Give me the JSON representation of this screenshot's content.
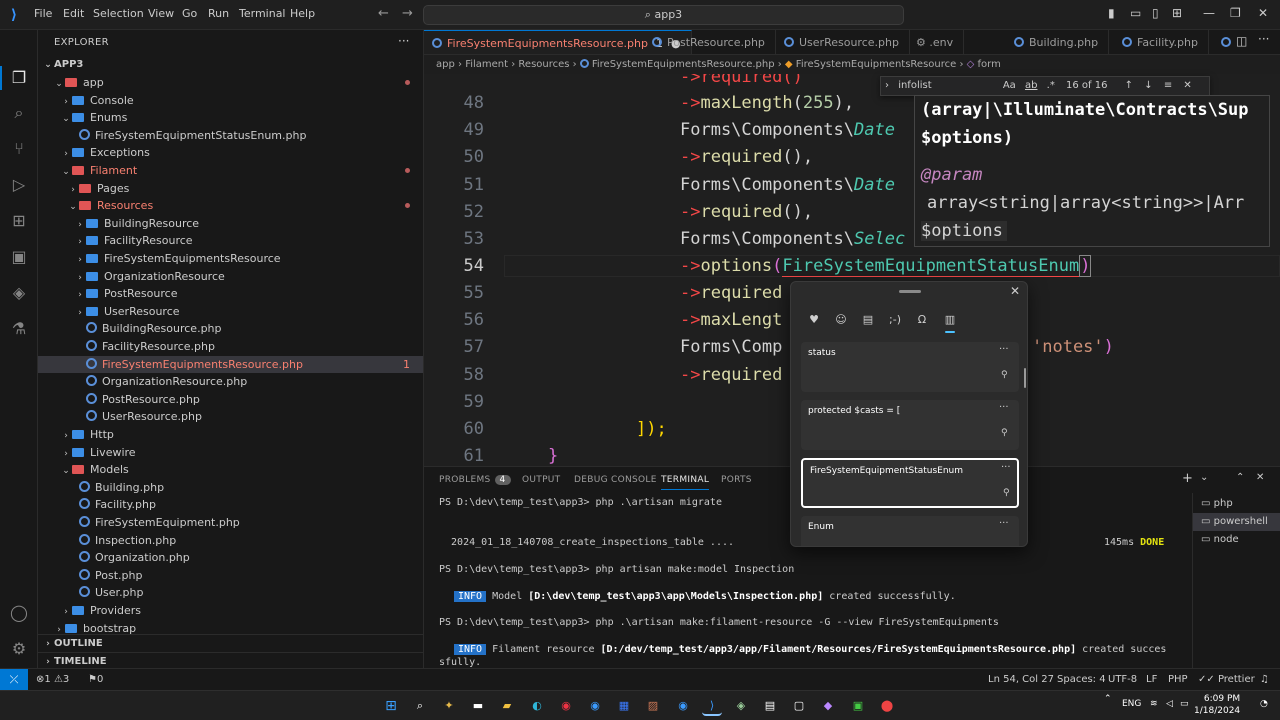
{
  "menu": [
    "File",
    "Edit",
    "Selection",
    "View",
    "Go",
    "Run",
    "Terminal",
    "Help"
  ],
  "command_center": "app3",
  "explorer": {
    "title": "EXPLORER",
    "root": "APP3",
    "tree": [
      {
        "label": "app",
        "depth": 1,
        "type": "folder-red",
        "open": true,
        "mod": true
      },
      {
        "label": "Console",
        "depth": 2,
        "type": "folder",
        "open": false
      },
      {
        "label": "Enums",
        "depth": 2,
        "type": "folder",
        "open": true
      },
      {
        "label": "FireSystemEquipmentStatusEnum.php",
        "depth": 3,
        "type": "php"
      },
      {
        "label": "Exceptions",
        "depth": 2,
        "type": "folder",
        "open": false
      },
      {
        "label": "Filament",
        "depth": 2,
        "type": "folder-red",
        "open": true,
        "mod": true,
        "cls": "error"
      },
      {
        "label": "Pages",
        "depth": 3,
        "type": "folder-red",
        "open": false
      },
      {
        "label": "Resources",
        "depth": 3,
        "type": "folder-red",
        "open": true,
        "mod": true,
        "cls": "error"
      },
      {
        "label": "BuildingResource",
        "depth": 4,
        "type": "folder",
        "open": false
      },
      {
        "label": "FacilityResource",
        "depth": 4,
        "type": "folder",
        "open": false
      },
      {
        "label": "FireSystemEquipmentsResource",
        "depth": 4,
        "type": "folder",
        "open": false
      },
      {
        "label": "OrganizationResource",
        "depth": 4,
        "type": "folder",
        "open": false
      },
      {
        "label": "PostResource",
        "depth": 4,
        "type": "folder",
        "open": false
      },
      {
        "label": "UserResource",
        "depth": 4,
        "type": "folder",
        "open": false
      },
      {
        "label": "BuildingResource.php",
        "depth": 4,
        "type": "php"
      },
      {
        "label": "FacilityResource.php",
        "depth": 4,
        "type": "php"
      },
      {
        "label": "FireSystemEquipmentsResource.php",
        "depth": 4,
        "type": "php",
        "sel": true,
        "cls": "error",
        "badge": "1"
      },
      {
        "label": "OrganizationResource.php",
        "depth": 4,
        "type": "php"
      },
      {
        "label": "PostResource.php",
        "depth": 4,
        "type": "php"
      },
      {
        "label": "UserResource.php",
        "depth": 4,
        "type": "php"
      },
      {
        "label": "Http",
        "depth": 2,
        "type": "folder",
        "open": false
      },
      {
        "label": "Livewire",
        "depth": 2,
        "type": "folder",
        "open": false
      },
      {
        "label": "Models",
        "depth": 2,
        "type": "folder-red",
        "open": true
      },
      {
        "label": "Building.php",
        "depth": 3,
        "type": "php"
      },
      {
        "label": "Facility.php",
        "depth": 3,
        "type": "php"
      },
      {
        "label": "FireSystemEquipment.php",
        "depth": 3,
        "type": "php"
      },
      {
        "label": "Inspection.php",
        "depth": 3,
        "type": "php"
      },
      {
        "label": "Organization.php",
        "depth": 3,
        "type": "php"
      },
      {
        "label": "Post.php",
        "depth": 3,
        "type": "php"
      },
      {
        "label": "User.php",
        "depth": 3,
        "type": "php"
      },
      {
        "label": "Providers",
        "depth": 2,
        "type": "folder",
        "open": false
      },
      {
        "label": "bootstrap",
        "depth": 1,
        "type": "folder",
        "open": false
      }
    ],
    "outline": "OUTLINE",
    "timeline": "TIMELINE"
  },
  "tabs": [
    {
      "label": "FireSystemEquipmentsResource.php",
      "active": true,
      "dirty": "1"
    },
    {
      "label": "PostResource.php"
    },
    {
      "label": "UserResource.php"
    },
    {
      "label": ".env"
    },
    {
      "label": "Building.php"
    },
    {
      "label": "Facility.php"
    }
  ],
  "breadcrumb": [
    "app",
    "Filament",
    "Resources",
    "FireSystemEquipmentsResource.php",
    "FireSystemEquipmentsResource",
    "form"
  ],
  "editor": {
    "line_numbers": [
      "48",
      "49",
      "50",
      "51",
      "52",
      "53",
      "54",
      "55",
      "56",
      "57",
      "58",
      "59",
      "60",
      "61"
    ],
    "top_partial": "->required()",
    "lines": {
      "l48": [
        "->",
        "maxLength",
        "(",
        "255",
        "),"
      ],
      "l49": [
        "Forms\\Components\\",
        "Date"
      ],
      "l50": [
        "->",
        "required",
        "(),"
      ],
      "l51": [
        "Forms\\Components\\",
        "Date"
      ],
      "l52": [
        "->",
        "required",
        "(),"
      ],
      "l53": [
        "Forms\\Components\\",
        "Selec"
      ],
      "l54": [
        "->",
        "options",
        "(",
        "FireSystemEquipmentStatusEnum",
        ")"
      ],
      "l55": [
        "->",
        "required"
      ],
      "l56": [
        "->",
        "maxLengt"
      ],
      "l57": [
        "Forms\\Comp",
        "'notes'",
        ")"
      ],
      "l58": [
        "->",
        "required"
      ],
      "l60": "]);",
      "l61": "}"
    }
  },
  "hover": {
    "sig1": "(array|\\Illuminate\\Contracts\\Sup",
    "sig2": "$options)",
    "param_tag": "@param",
    "param_type": "array<string|array<string>>|Arr",
    "param_name": "$options"
  },
  "find": {
    "query": "infolist",
    "aa": "Aa",
    "ab": "ab",
    "regex": ".*",
    "count": "16 of 16"
  },
  "panel": {
    "tabs": [
      "PROBLEMS",
      "OUTPUT",
      "DEBUG CONSOLE",
      "TERMINAL",
      "PORTS"
    ],
    "problems_count": "4",
    "terminal": {
      "l1": "PS D:\\dev\\temp_test\\app3> php .\\artisan migrate",
      "l2": "  2024_01_18_140708_create_inspections_table ....",
      "l2_time": "145ms",
      "l2_done": "DONE",
      "l3": "PS D:\\dev\\temp_test\\app3> php artisan make:model Inspection",
      "l4_info": "INFO",
      "l4_text": " Model ",
      "l4_path": "[D:\\dev\\temp_test\\app3\\app\\Models\\Inspection.php]",
      "l4_end": " created successfully.",
      "l5": "PS D:\\dev\\temp_test\\app3> php .\\artisan make:filament-resource -G --view FireSystemEquipments",
      "l6_info": "INFO",
      "l6_text": " Filament resource ",
      "l6_path": "[D:/dev/temp_test/app3/app/Filament/Resources/FireSystemEquipmentsResource.php]",
      "l6_end": " created succes",
      "l7": "sfully."
    },
    "term_list": [
      "php",
      "powershell",
      "node"
    ]
  },
  "clipboard": {
    "items": [
      "status",
      "protected $casts = [",
      "FireSystemEquipmentStatusEnum",
      "Enum"
    ]
  },
  "status": {
    "errors": "1",
    "warnings": "3",
    "ports": "0",
    "pos": "Ln 54, Col 27",
    "spaces": "Spaces: 4",
    "encoding": "UTF-8",
    "eol": "LF",
    "lang": "PHP",
    "prettier": "Prettier"
  },
  "taskbar": {
    "lang": "ENG",
    "time": "6:09 PM",
    "date": "1/18/2024"
  },
  "colors": {
    "accent": "#0078d4",
    "error": "#f88070",
    "function": "#dcdcaa",
    "class": "#4ec9b0",
    "string": "#ce9178"
  }
}
